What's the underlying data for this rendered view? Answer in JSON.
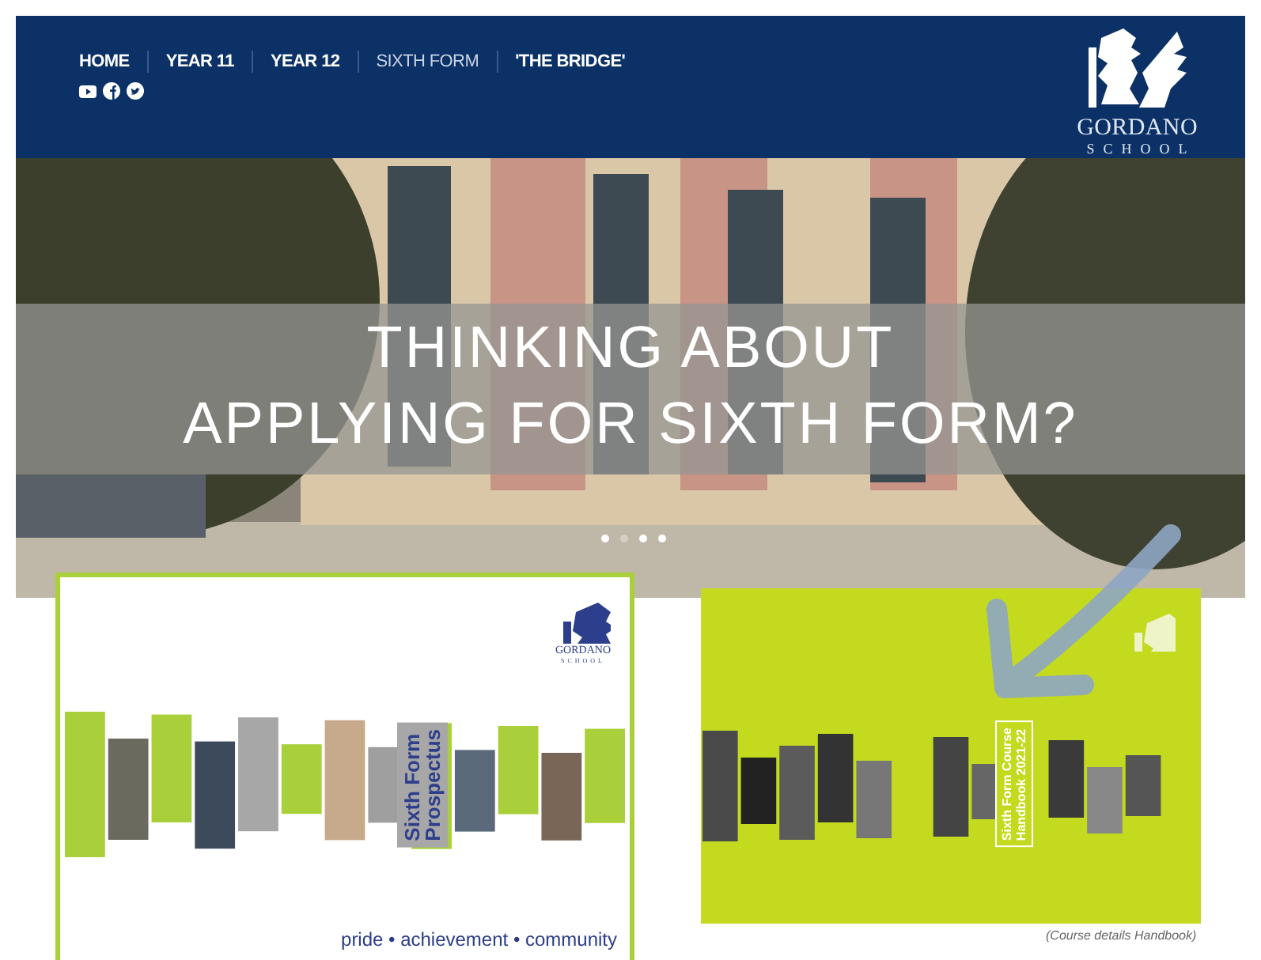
{
  "nav": {
    "items": [
      {
        "label": "HOME",
        "selected": false
      },
      {
        "label": "YEAR 11",
        "selected": false
      },
      {
        "label": "YEAR 12",
        "selected": false
      },
      {
        "label": "SIXTH FORM",
        "selected": true
      },
      {
        "label": "'THE BRIDGE'",
        "selected": false
      }
    ],
    "social": [
      {
        "kind": "video"
      },
      {
        "kind": "facebook"
      },
      {
        "kind": "bird"
      }
    ]
  },
  "logo": {
    "name": "GORDANO",
    "subtitle": "SCHOOL"
  },
  "hero": {
    "kind": "picture",
    "headline": [
      "THINKING ABOUT",
      "APPLYING FOR SIXTH FORM?"
    ],
    "dots": [
      {
        "selected": false
      },
      {
        "selected": true
      },
      {
        "selected": false
      },
      {
        "selected": false
      }
    ]
  },
  "documents": [
    {
      "kind": "prospectus",
      "logo_name": "GORDANO",
      "logo_subtitle": "SCHOOL",
      "title": [
        "Sixth Form",
        "Prospectus"
      ],
      "tagline": "pride • achievement • community"
    },
    {
      "kind": "handbook",
      "title": [
        "Sixth Form Course",
        "Handbook 2021-22"
      ],
      "caption": "(Course details Handbook)"
    }
  ]
}
